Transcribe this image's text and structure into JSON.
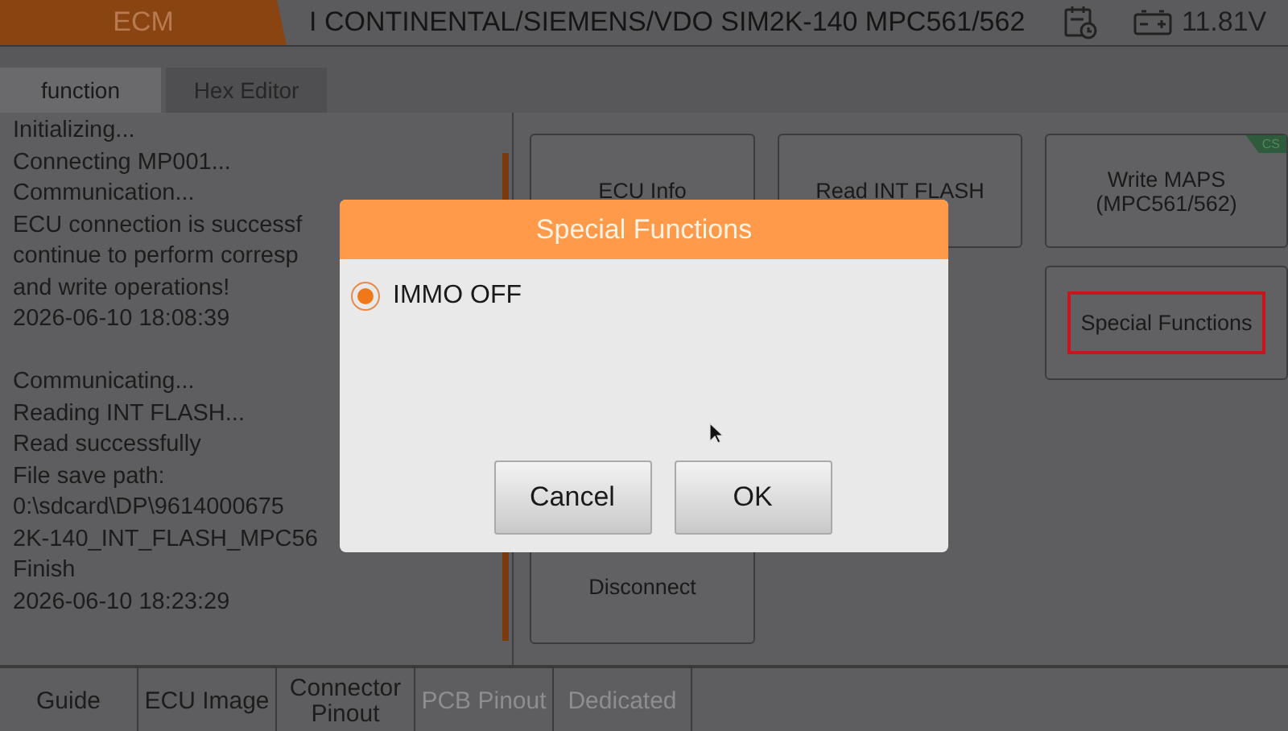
{
  "top_bar": {
    "module": "ECM",
    "title": "I CONTINENTAL/SIEMENS/VDO SIM2K-140 MPC561/562",
    "voltage": "11.81V"
  },
  "tabs": [
    {
      "label": "function",
      "selected": true
    },
    {
      "label": "Hex Editor",
      "selected": false
    }
  ],
  "log": [
    [
      "Initializing...",
      "Connecting MP001...",
      "Communication...",
      "ECU connection is successf",
      "continue to perform corresp",
      "and write operations!",
      "2026-06-10 18:08:39"
    ],
    [
      "Communicating...",
      "Reading INT FLASH...",
      "Read successfully",
      "File save path:",
      "0:\\sdcard\\DP\\9614000675",
      "2K-140_INT_FLASH_MPC56",
      "Finish",
      "2026-06-10 18:23:29"
    ]
  ],
  "function_buttons": [
    {
      "kind": "button",
      "label": "ECU Info",
      "highlighted": false
    },
    {
      "kind": "button",
      "label": "Read INT FLASH",
      "highlighted": false
    },
    {
      "kind": "button",
      "label": "Write MAPS\n(MPC561/562)",
      "badge": "CS",
      "highlighted": false
    },
    {
      "kind": "spacer"
    },
    {
      "kind": "spacer"
    },
    {
      "kind": "button",
      "label": "Special Functions",
      "highlighted": true
    },
    {
      "kind": "spacer"
    },
    {
      "kind": "spacer"
    },
    {
      "kind": "spacer"
    },
    {
      "kind": "button",
      "label": "Disconnect",
      "highlighted": false
    }
  ],
  "bottom_tabs": [
    {
      "label": "Guide",
      "disabled": false
    },
    {
      "label": "ECU Image",
      "disabled": false
    },
    {
      "label": "Connector Pinout",
      "disabled": false
    },
    {
      "label": "PCB Pinout",
      "disabled": true
    },
    {
      "label": "Dedicated",
      "disabled": true
    }
  ],
  "dialog": {
    "title": "Special Functions",
    "options": [
      {
        "label": "IMMO OFF",
        "selected": true
      }
    ],
    "buttons": [
      "Cancel",
      "OK"
    ]
  }
}
